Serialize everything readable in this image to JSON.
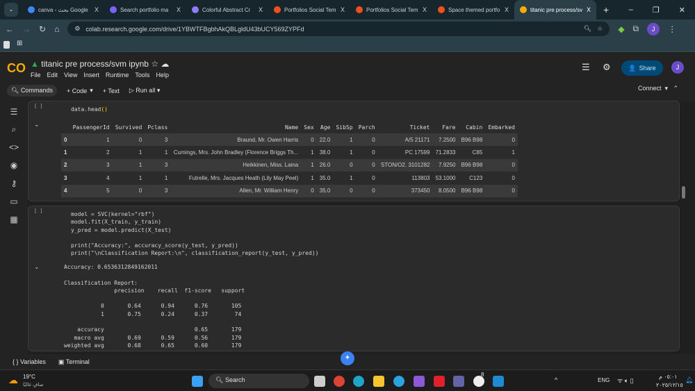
{
  "browser": {
    "tabs": [
      {
        "title": "canva - بحث Google",
        "color": "#4285f4"
      },
      {
        "title": "Search portfolio ma",
        "color": "#7b61ff"
      },
      {
        "title": "Colorful Abstract Cr",
        "color": "#8e7cff"
      },
      {
        "title": "Portfolios Social Tem",
        "color": "#f24e1e"
      },
      {
        "title": "Portfolios Social Tem",
        "color": "#f24e1e"
      },
      {
        "title": "Space themed portfo",
        "color": "#f24e1e"
      },
      {
        "title": "titanic pre process/sv",
        "color": "#f9ab00"
      }
    ],
    "close": "X",
    "new_tab": "+",
    "url": "colab.research.google.com/drive/1YBWTFBgbhAkQBLgldU43bUCY569ZYPFd",
    "profile": "J"
  },
  "colab": {
    "logo": "CO",
    "title": "titanic pre process/svm ipynb",
    "menu": [
      "File",
      "Edit",
      "View",
      "Insert",
      "Runtime",
      "Tools",
      "Help"
    ],
    "toolbar": {
      "commands": "Commands",
      "code": "+ Code",
      "text": "+ Text",
      "run_all": "Run all",
      "connect": "Connect"
    },
    "share": "Share",
    "avatar": "J"
  },
  "cell1": {
    "bracket": "[ ]",
    "code": "data.head",
    "columns": [
      "",
      "PassengerId",
      "Survived",
      "Pclass",
      "Name",
      "Sex",
      "Age",
      "SibSp",
      "Parch",
      "Ticket",
      "Fare",
      "Cabin",
      "Embarked"
    ],
    "rows": [
      [
        "0",
        "1",
        "0",
        "3",
        "Braund, Mr. Owen Harris",
        "0",
        "22.0",
        "1",
        "0",
        "A/5 21171",
        "7.2500",
        "B96 B98",
        "0"
      ],
      [
        "1",
        "2",
        "1",
        "1",
        "Cumings, Mrs. John Bradley (Florence Briggs Th...",
        "1",
        "38.0",
        "1",
        "0",
        "PC 17599",
        "71.2833",
        "C85",
        "1"
      ],
      [
        "2",
        "3",
        "1",
        "3",
        "Heikkinen, Miss. Laina",
        "1",
        "26.0",
        "0",
        "0",
        "STON/O2. 3101282",
        "7.9250",
        "B96 B98",
        "0"
      ],
      [
        "3",
        "4",
        "1",
        "1",
        "Futrelle, Mrs. Jacques Heath (Lily May Peel)",
        "1",
        "35.0",
        "1",
        "0",
        "113803",
        "53.1000",
        "C123",
        "0"
      ],
      [
        "4",
        "5",
        "0",
        "3",
        "Allen, Mr. William Henry",
        "0",
        "35.0",
        "0",
        "0",
        "373450",
        "8.0500",
        "B96 B98",
        "0"
      ]
    ]
  },
  "cell2": {
    "bracket": "[ ]",
    "code_lines": [
      "model = SVC(kernel=\"rbf\")",
      "model.fit(X_train, y_train)",
      "y_pred = model.predict(X_test)",
      "",
      "print(\"Accuracy:\", accuracy_score(y_test, y_pred))",
      "print(\"\\nClassification Report:\\n\", classification_report(y_test, y_pred))"
    ],
    "output": "Accuracy: 0.6536312849162011\n\nClassification Report:\n               precision    recall  f1-score   support\n\n           0       0.64      0.94      0.76       105\n           1       0.75      0.24      0.37        74\n\n    accuracy                           0.65       179\n   macro avg       0.69      0.59      0.56       179\nweighted avg       0.68      0.65      0.60       179"
  },
  "bottom": {
    "variables": "Variables",
    "terminal": "Terminal"
  },
  "taskbar": {
    "temp": "19°C",
    "weather": "صافٍ غالبًا",
    "search": "Search",
    "lang": "ENG",
    "time": "٠٥:٠١ م",
    "date": "٢٠٢٥/١٢/١٥",
    "whatsapp_badge": "8"
  }
}
